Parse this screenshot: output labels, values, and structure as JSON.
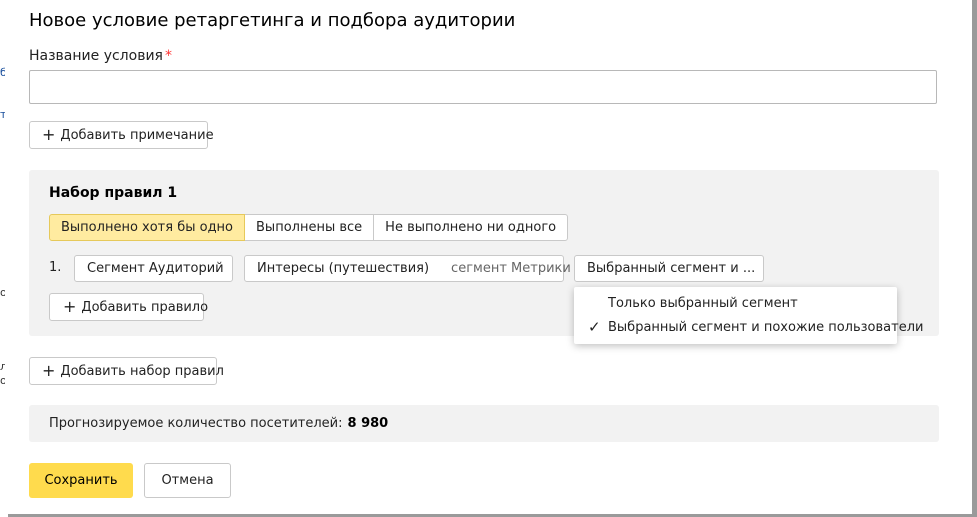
{
  "background_fragments": [
    "б",
    "т",
    "о",
    "л",
    "о"
  ],
  "dialog": {
    "title": "Новое условие ретаргетинга и подбора аудитории"
  },
  "name_field": {
    "label": "Название условия",
    "required_mark": "*",
    "value": "",
    "placeholder": ""
  },
  "add_note_label": "Добавить примечание",
  "ruleset": {
    "title": "Набор правил 1",
    "modes": [
      {
        "label": "Выполнено хотя бы одно",
        "selected": true
      },
      {
        "label": "Выполнены все",
        "selected": false
      },
      {
        "label": "Не выполнено ни одного",
        "selected": false
      }
    ],
    "rule": {
      "number": "1.",
      "type_select": "Сегмент Аудиторий",
      "segment_select": "Интересы (путешествия)",
      "segment_source": "сегмент Метрики",
      "scope_select": "Выбранный сегмент и ..."
    },
    "add_rule_label": "Добавить правило"
  },
  "scope_dropdown": {
    "options": [
      {
        "label": "Только выбранный сегмент",
        "checked": false
      },
      {
        "label": "Выбранный сегмент и похожие пользователи",
        "checked": true
      }
    ]
  },
  "add_ruleset_label": "Добавить набор правил",
  "forecast": {
    "label": "Прогнозируемое количество посетителей:",
    "value": "8 980"
  },
  "actions": {
    "save_label": "Сохранить",
    "cancel_label": "Отмена"
  },
  "colors": {
    "accent_yellow": "#ffdb4d",
    "selected_tab": "#ffeba0",
    "panel_bg": "#f2f2f2",
    "required": "#ff3333"
  },
  "icons": [
    "plus-icon",
    "chevron-down-icon",
    "chevron-up-icon",
    "checkmark-icon"
  ]
}
